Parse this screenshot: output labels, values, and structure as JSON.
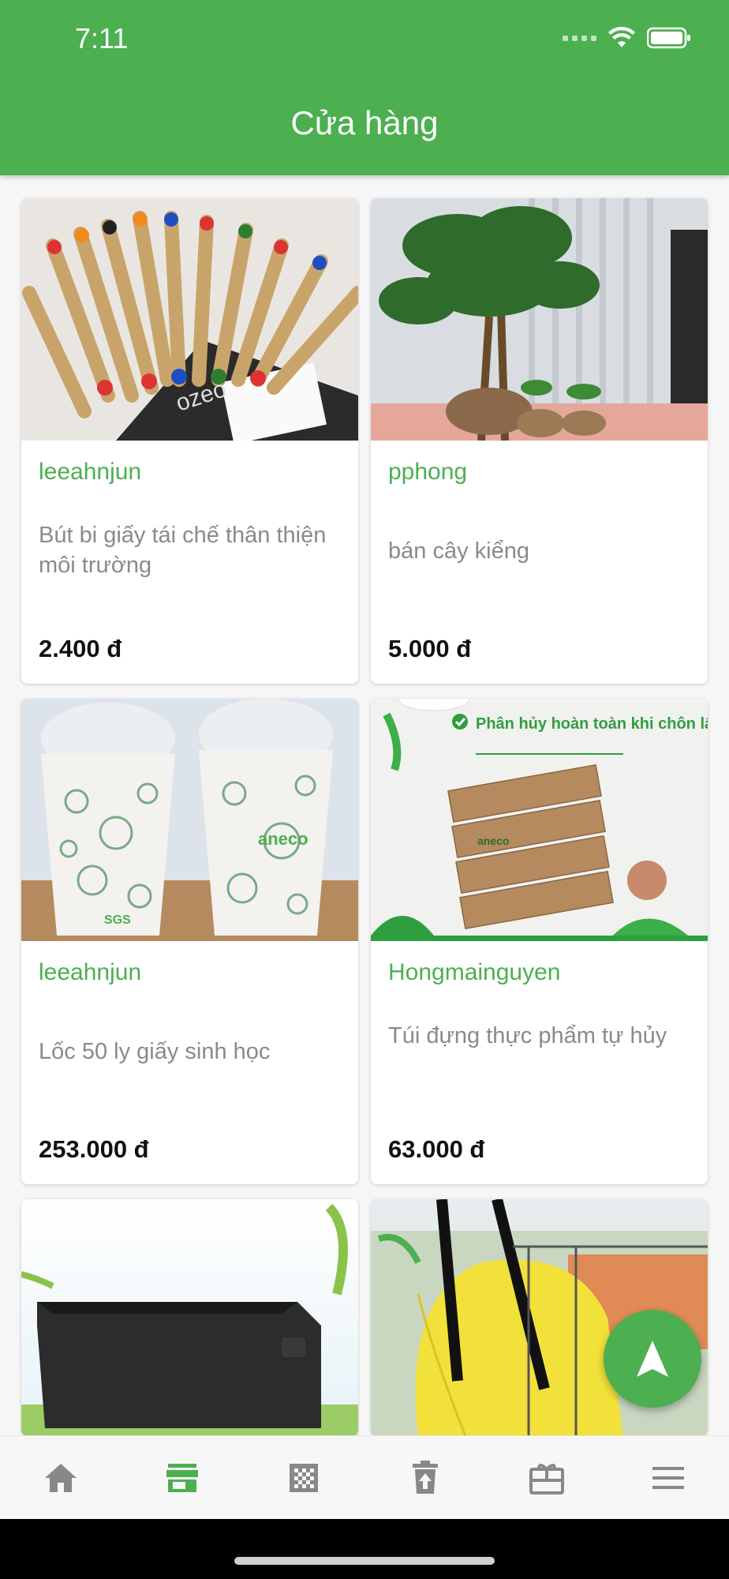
{
  "status_bar": {
    "time": "7:11"
  },
  "header": {
    "title": "Cửa hàng"
  },
  "products": [
    {
      "seller": "leeahnjun",
      "name": "Bút bi giấy tái chế thân thiện môi trường",
      "price": "2.400 đ"
    },
    {
      "seller": "pphong",
      "name": "bán cây kiểng",
      "price": "5.000 đ"
    },
    {
      "seller": "leeahnjun",
      "name": "Lốc 50 ly giấy sinh học",
      "price": "253.000 đ"
    },
    {
      "seller": "Hongmainguyen",
      "name": "Túi đựng thực phẩm tự hủy",
      "price": "63.000 đ"
    }
  ],
  "image_text": {
    "pens_logo": "ozeo",
    "cups_logo": "aneco",
    "cups_badge": "SGS",
    "bags_banner": "Phân hủy hoàn toàn khi chôn lấp",
    "bags_logo": "aneco"
  },
  "bottom_nav": [
    {
      "icon": "home-icon"
    },
    {
      "icon": "store-icon",
      "active": true
    },
    {
      "icon": "grid-icon"
    },
    {
      "icon": "trash-upload-icon"
    },
    {
      "icon": "gift-icon"
    },
    {
      "icon": "menu-icon"
    }
  ],
  "colors": {
    "primary": "#4caf50",
    "inactive": "#888888"
  }
}
